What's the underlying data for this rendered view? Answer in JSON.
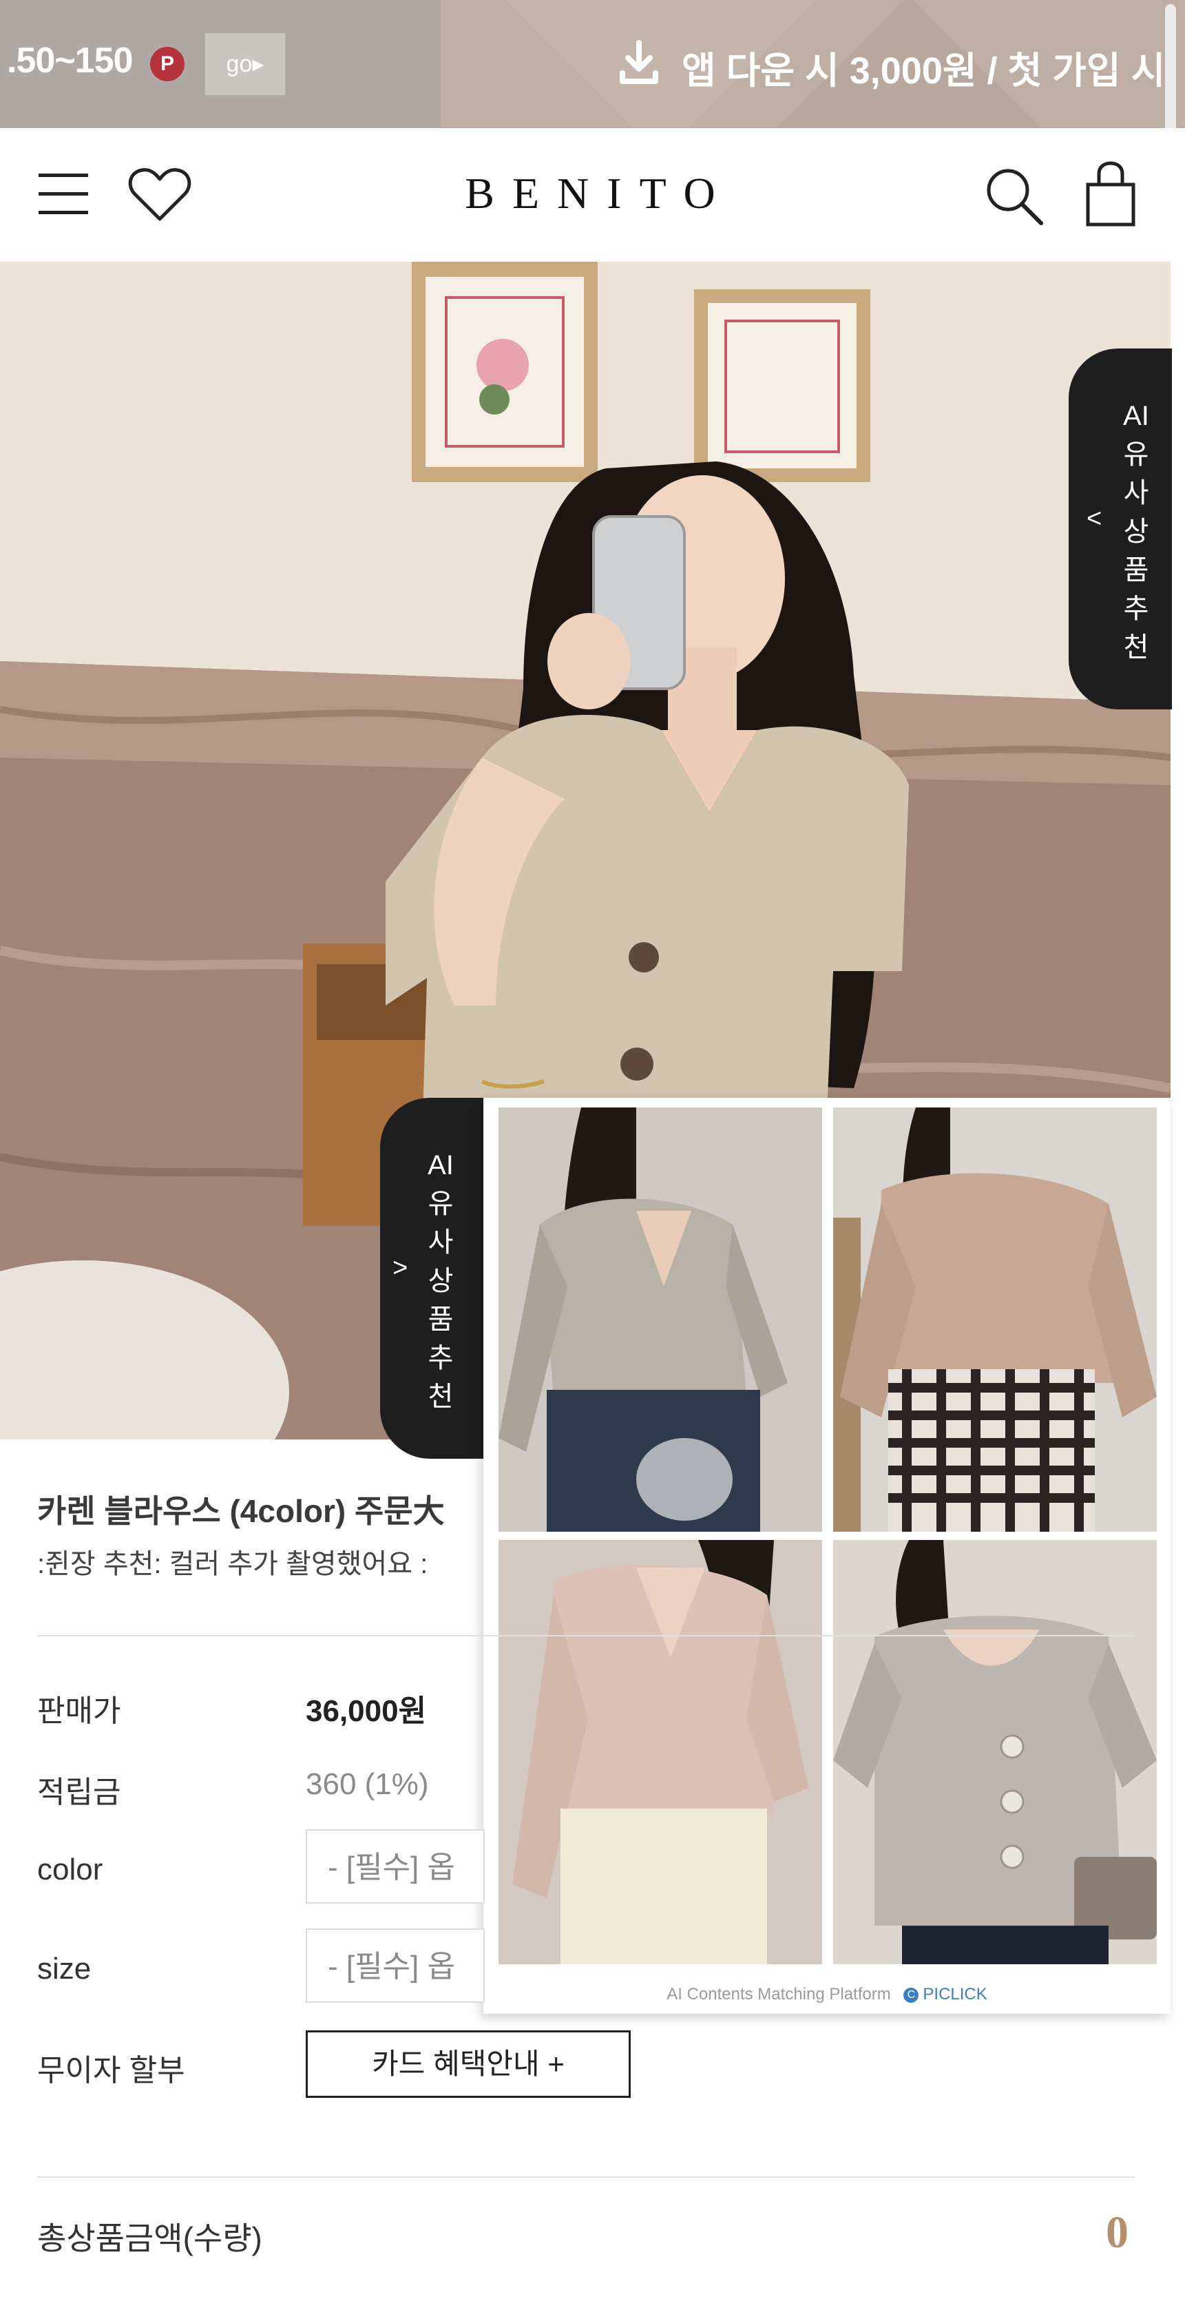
{
  "promo": {
    "point_range": ".50~150",
    "point_badge": "P",
    "go_label": "go▸",
    "app_text": "앱 다운 시 3,000원 / 첫 가입 시"
  },
  "header": {
    "logo": "BENITO",
    "icons": [
      "menu-icon",
      "heart-icon",
      "search-icon",
      "bag-icon"
    ]
  },
  "ai_tab": {
    "arrow_collapsed": "<",
    "arrow_expanded": ">",
    "label": "AI 유사상품추천"
  },
  "recommendation": {
    "footer_text": "AI Contents Matching Platform",
    "footer_brand": "PICLICK"
  },
  "product": {
    "title": "카렌 블라우스 (4color) 주문大",
    "subtitle": ":쥔장 추천: 컬러 추가 촬영했어요 :",
    "price_label": "판매가",
    "price_value": "36,000원",
    "points_label": "적립금",
    "points_value": "360 (1%)",
    "color_label": "color",
    "color_select": "- [필수] 옵",
    "size_label": "size",
    "size_select": "- [필수] 옵",
    "installment_label": "무이자 할부",
    "card_button": "카드 혜택안내 +",
    "total_label": "총상품금액(수량)",
    "total_value": "0"
  },
  "colors": {
    "banner_left": "#aea9a5",
    "banner_right": "#bfaea3",
    "point_badge": "#b3323b",
    "ai_tab": "#1e1e1e",
    "total_accent": "#b68f6c"
  }
}
